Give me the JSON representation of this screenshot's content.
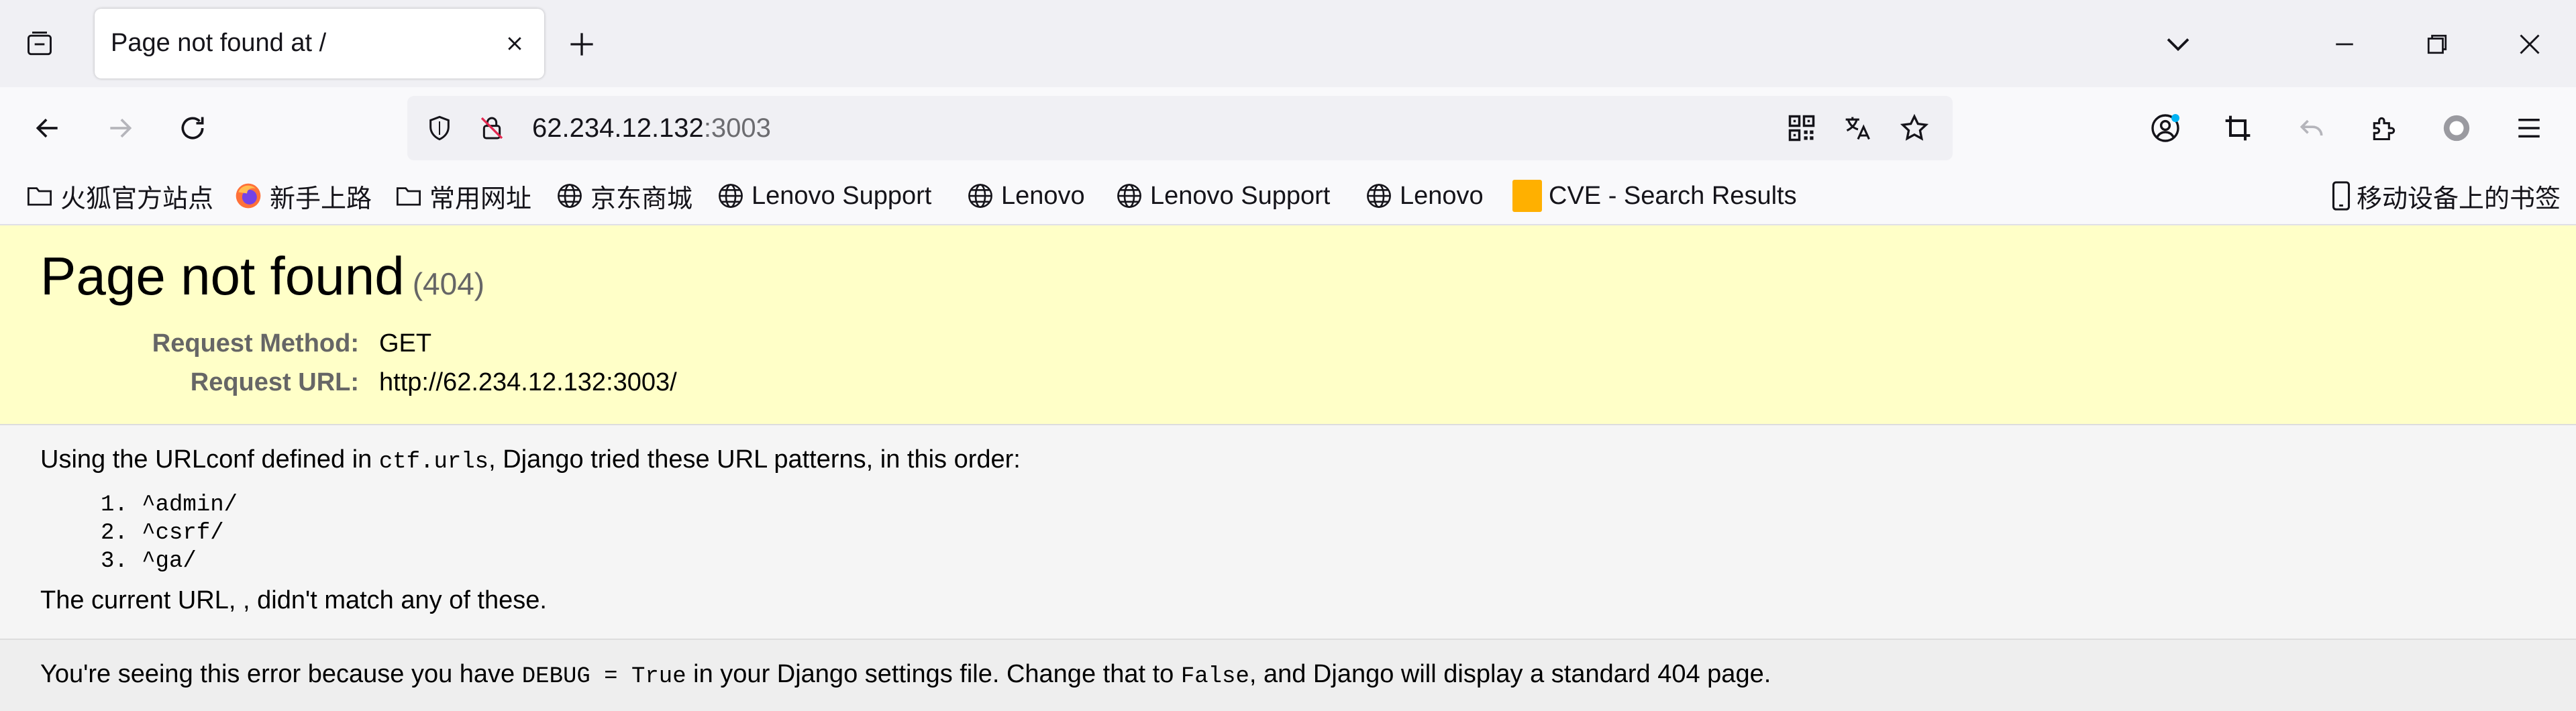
{
  "tab": {
    "title": "Page not found at /"
  },
  "urlbar": {
    "host": "62.234.12.132",
    "port": ":3003"
  },
  "bookmarks": [
    {
      "label": "火狐官方站点",
      "icon": "folder-icon"
    },
    {
      "label": "新手上路",
      "icon": "firefox-icon"
    },
    {
      "label": "常用网址",
      "icon": "folder-icon"
    },
    {
      "label": "京东商城",
      "icon": "globe-icon"
    },
    {
      "label": "Lenovo Support",
      "icon": "globe-icon"
    },
    {
      "label": "Lenovo",
      "icon": "globe-icon"
    },
    {
      "label": "Lenovo Support",
      "icon": "globe-icon"
    },
    {
      "label": "Lenovo",
      "icon": "globe-icon"
    },
    {
      "label": "CVE - Search Results",
      "icon": "cve-favicon"
    }
  ],
  "mobile_bookmarks": {
    "label": "移动设备上的书签",
    "icon": "mobile-device-icon"
  },
  "page": {
    "title": "Page not found",
    "code": "(404)",
    "request_method_label": "Request Method:",
    "request_method": "GET",
    "request_url_label": "Request URL:",
    "request_url": "http://62.234.12.132:3003/",
    "urlconf_prefix": "Using the URLconf defined in ",
    "urlconf_module": "ctf.urls",
    "urlconf_suffix": ", Django tried these URL patterns, in this order:",
    "patterns": [
      "1. ^admin/",
      "2. ^csrf/",
      "3. ^ga/"
    ],
    "no_match": "The current URL, , didn't match any of these.",
    "explanation_prefix": "You're seeing this error because you have ",
    "explanation_code1": "DEBUG = True",
    "explanation_mid": " in your Django settings file. Change that to ",
    "explanation_code2": "False",
    "explanation_suffix": ", and Django will display a standard 404 page."
  },
  "colors": {
    "summary_bg": "#ffffc8",
    "info_bg": "#f5f5f5",
    "explanation_bg": "#eeeeee",
    "cve_favicon": "#ffb000",
    "account_badge": "#00b3f4"
  }
}
